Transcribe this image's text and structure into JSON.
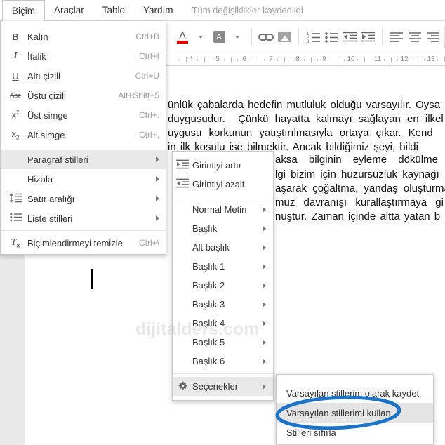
{
  "menubar": {
    "items": [
      "Biçim",
      "Araçlar",
      "Tablo",
      "Yardım"
    ],
    "open_menu": "Biçim",
    "status": "Tüm değişiklikler kaydedildi"
  },
  "toolbar": {
    "buttons": [
      "text-color",
      "highlight-color",
      "insert-link",
      "insert-image",
      "numbered-list",
      "bulleted-list",
      "indent-decrease",
      "indent-increase",
      "align-left",
      "align-center",
      "align-right",
      "align-justify",
      "line-spacing"
    ],
    "active_button": "align-justify",
    "text_color_underline": "#e60000"
  },
  "ruler": {
    "numbers": [
      "4",
      "5",
      "6",
      "7",
      "8",
      "9",
      "10",
      "11",
      "12",
      "13"
    ]
  },
  "format_menu": {
    "items": [
      {
        "icon": "bold-icon",
        "label": "Kalın",
        "shortcut": "Ctrl+B"
      },
      {
        "icon": "italic-icon",
        "label": "İtalik",
        "shortcut": "Ctrl+I"
      },
      {
        "icon": "underline-icon",
        "label": "Altı çizili",
        "shortcut": "Ctrl+U"
      },
      {
        "icon": "strikethrough-icon",
        "label": "Üstü çizili",
        "shortcut": "Alt+Shift+5"
      },
      {
        "icon": "superscript-icon",
        "label": "Üst simge",
        "shortcut": "Ctrl+."
      },
      {
        "icon": "subscript-icon",
        "label": "Alt simge",
        "shortcut": "Ctrl+,"
      },
      {
        "label": "Paragraf stilleri",
        "submenu": true,
        "highlighted": true
      },
      {
        "label": "Hizala",
        "submenu": true
      },
      {
        "icon": "line-spacing-icon",
        "label": "Satır aralığı",
        "submenu": true
      },
      {
        "icon": "list-styles-icon",
        "label": "Liste stilleri",
        "submenu": true
      },
      {
        "icon": "clear-formatting-icon",
        "label": "Biçimlendirmeyi temizle",
        "shortcut": "Ctrl+\\"
      }
    ]
  },
  "styles_submenu": {
    "items": [
      {
        "icon": "indent-increase-icon",
        "label": "Girintiyi artır"
      },
      {
        "icon": "indent-decrease-icon",
        "label": "Girintiyi azalt"
      },
      {
        "label": "Normal Metin",
        "submenu": true
      },
      {
        "label": "Başlık",
        "submenu": true
      },
      {
        "label": "Alt başlık",
        "submenu": true
      },
      {
        "label": "Başlık 1",
        "submenu": true
      },
      {
        "label": "Başlık 2",
        "submenu": true
      },
      {
        "label": "Başlık 3",
        "submenu": true
      },
      {
        "label": "Başlık 4",
        "submenu": true
      },
      {
        "label": "Başlık 5",
        "submenu": true
      },
      {
        "label": "Başlık 6",
        "submenu": true
      },
      {
        "icon": "gear-icon",
        "label": "Seçenekler",
        "submenu": true,
        "highlighted": true
      }
    ]
  },
  "options_submenu": {
    "items": [
      {
        "label": "Varsayılan stillerim olarak kaydet"
      },
      {
        "label": "Varsayılan stillerimi kullan",
        "highlighted": true,
        "circled": true
      },
      {
        "label": "Stilleri sıfırla"
      }
    ],
    "annotation_color": "#1d74c6"
  },
  "document": {
    "lines": [
      {
        "text": "ünlük çabalarda hedefin mutluluk olduğu varsayılır. Oysa"
      },
      {
        "text": "duygusudur.  Çünkü hayatta kalmayı sağlayan en ilkel"
      },
      {
        "text": "uygusu korkunun yatıştırılmasıyla ortaya çıkar. Kend"
      },
      {
        "text": "in ilk koşulu ise bilmektir. Ancak bildiğimiz şeyi, bildi"
      },
      {
        "text": "aksa bilginin eyleme dökülme"
      },
      {
        "text": "lgi bizim için huzursuzluk kaynağı"
      },
      {
        "text": "aşarak çoğaltma, yandaş oluşturma"
      },
      {
        "text": "muz davranışı kurallaştırmaya gi"
      },
      {
        "text": "nuştur. Zaman içinde altta yatan b"
      }
    ]
  },
  "watermark": {
    "text": "dijitalders.com"
  }
}
